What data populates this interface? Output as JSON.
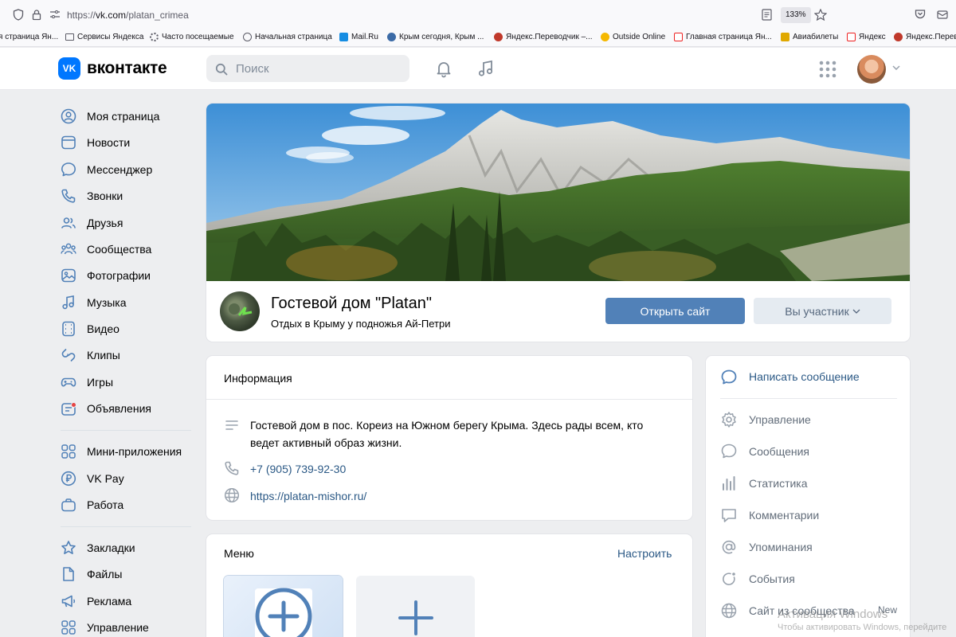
{
  "browser": {
    "url_prefix": "https://",
    "url_host": "vk.com",
    "url_path": "/platan_crimea",
    "zoom": "133%",
    "bookmarks": [
      "я страница Ян...",
      "Сервисы Яндекса",
      "Часто посещаемые",
      "Начальная страница",
      "Mail.Ru",
      "Крым сегодня, Крым ...",
      "Яндекс.Переводчик –...",
      "Outside Online",
      "Главная страница Ян...",
      "Авиабилеты",
      "Яндекс",
      "Яндекс.Перевод"
    ]
  },
  "header": {
    "logo_short": "VK",
    "logo_text": "вконтакте",
    "search_placeholder": "Поиск"
  },
  "nav": {
    "items": [
      {
        "label": "Моя страница",
        "icon": "user-circle-icon"
      },
      {
        "label": "Новости",
        "icon": "newspaper-icon"
      },
      {
        "label": "Мессенджер",
        "icon": "message-icon"
      },
      {
        "label": "Звонки",
        "icon": "phone-icon"
      },
      {
        "label": "Друзья",
        "icon": "friends-icon"
      },
      {
        "label": "Сообщества",
        "icon": "communities-icon"
      },
      {
        "label": "Фотографии",
        "icon": "photo-icon"
      },
      {
        "label": "Музыка",
        "icon": "music-icon"
      },
      {
        "label": "Видео",
        "icon": "video-icon"
      },
      {
        "label": "Клипы",
        "icon": "clips-icon"
      },
      {
        "label": "Игры",
        "icon": "gamepad-icon"
      },
      {
        "label": "Объявления",
        "icon": "ads-icon"
      }
    ],
    "items2": [
      {
        "label": "Мини-приложения",
        "icon": "apps-icon"
      },
      {
        "label": "VK Pay",
        "icon": "ruble-icon"
      },
      {
        "label": "Работа",
        "icon": "briefcase-icon"
      }
    ],
    "items3": [
      {
        "label": "Закладки",
        "icon": "star-icon"
      },
      {
        "label": "Файлы",
        "icon": "file-icon"
      },
      {
        "label": "Реклама",
        "icon": "megaphone-icon"
      },
      {
        "label": "Управление",
        "icon": "grid-icon"
      }
    ]
  },
  "group": {
    "name": "Гостевой дом \"Platan\"",
    "status": "Отдых в Крыму у подножья Ай-Петри",
    "open_site": "Открыть сайт",
    "member": "Вы участник"
  },
  "info": {
    "title": "Информация",
    "description": "Гостевой дом в пос. Кореиз на Южном берегу Крыма. Здесь рады всем, кто ведет активный образ жизни.",
    "phone": "+7 (905) 739-92-30",
    "site": "https://platan-mishor.ru/"
  },
  "menu": {
    "title": "Меню",
    "configure": "Настроить"
  },
  "actions": {
    "write": "Написать сообщение",
    "items": [
      {
        "label": "Управление",
        "icon": "gear-icon"
      },
      {
        "label": "Сообщения",
        "icon": "message-icon"
      },
      {
        "label": "Статистика",
        "icon": "stats-icon"
      },
      {
        "label": "Комментарии",
        "icon": "comment-icon"
      },
      {
        "label": "Упоминания",
        "icon": "at-icon"
      },
      {
        "label": "События",
        "icon": "event-icon"
      },
      {
        "label": "Сайт из сообщества",
        "icon": "globe-icon"
      }
    ],
    "new_badge": "New"
  },
  "watermark": {
    "line1": "Активация Windows",
    "line2": "Чтобы активировать Windows, перейдите"
  }
}
